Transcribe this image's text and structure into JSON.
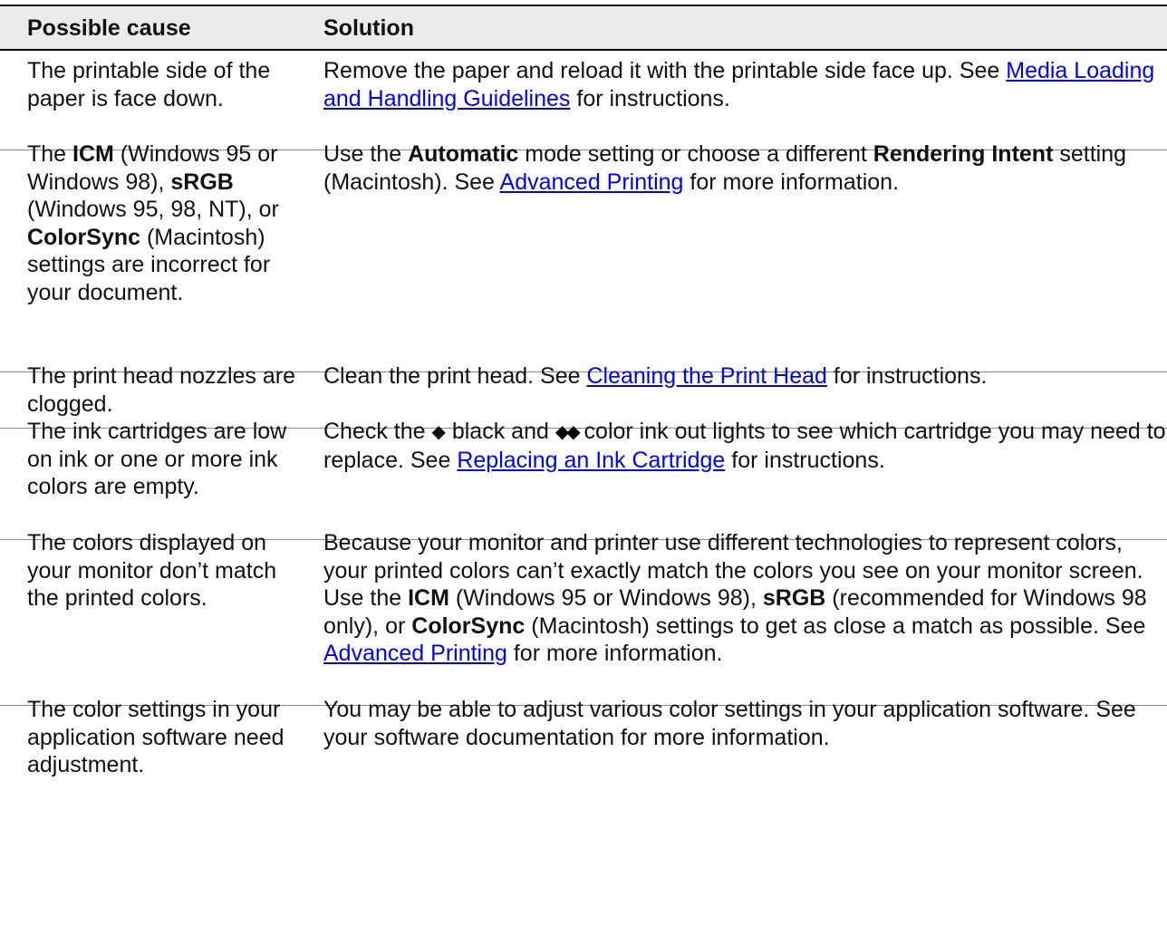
{
  "header": {
    "cause": "Possible cause",
    "solution": "Solution"
  },
  "rows": [
    {
      "cause": [
        [
          "t",
          "The printable side of the paper is face down."
        ]
      ],
      "solution": [
        [
          "t",
          "Remove the paper and reload it with the printable side face up. See "
        ],
        [
          "a",
          "Media Loading and Handling Guidelines"
        ],
        [
          "t",
          " for instructions."
        ]
      ]
    },
    {
      "cause": [
        [
          "t",
          "The "
        ],
        [
          "b",
          "ICM"
        ],
        [
          "t",
          " (Windows 95 or Windows 98), "
        ],
        [
          "b",
          "sRGB"
        ],
        [
          "t",
          " (Windows 95, 98, NT), or "
        ],
        [
          "b",
          "ColorSync"
        ],
        [
          "t",
          " (Macintosh) settings are incorrect for your document."
        ]
      ],
      "solution": [
        [
          "t",
          "Use the "
        ],
        [
          "b",
          "Automatic"
        ],
        [
          "t",
          " mode setting or choose a different "
        ],
        [
          "b",
          "Rendering Intent"
        ],
        [
          "t",
          " setting (Macintosh). See "
        ],
        [
          "a",
          "Advanced Printing"
        ],
        [
          "t",
          " for more information."
        ]
      ]
    },
    {
      "cause": [
        [
          "t",
          "The print head nozzles are clogged."
        ]
      ],
      "solution": [
        [
          "t",
          "Clean the print head. See "
        ],
        [
          "a",
          "Cleaning the Print Head"
        ],
        [
          "t",
          " for instructions."
        ]
      ]
    },
    {
      "cause": [
        [
          "t",
          "The ink cartridges are low on ink or one or more ink colors are empty."
        ]
      ],
      "solution": [
        [
          "t",
          "Check the "
        ],
        [
          "i",
          "black-ink-drop-icon"
        ],
        [
          "t",
          " black and "
        ],
        [
          "i",
          "color-ink-drops-icon"
        ],
        [
          "t",
          " color ink out lights to see which cartridge you may need to replace. See "
        ],
        [
          "a",
          "Replacing an Ink Cartridge"
        ],
        [
          "t",
          " for instructions."
        ]
      ]
    },
    {
      "cause": [
        [
          "t",
          "The colors displayed on your monitor don’t match the printed colors."
        ]
      ],
      "solution": [
        [
          "t",
          "Because your monitor and printer use different technologies to represent colors, your printed colors can’t exactly match the colors you see on your monitor screen. Use the "
        ],
        [
          "b",
          "ICM"
        ],
        [
          "t",
          " (Windows 95 or Windows 98), "
        ],
        [
          "b",
          "sRGB"
        ],
        [
          "t",
          " (recommended for Windows 98 only), or "
        ],
        [
          "b",
          "ColorSync"
        ],
        [
          "t",
          " (Macintosh) settings to get as close a match as possible. See "
        ],
        [
          "a",
          "Advanced Printing"
        ],
        [
          "t",
          " for more information."
        ]
      ]
    },
    {
      "cause": [
        [
          "t",
          "The color settings in your application software need adjustment."
        ]
      ],
      "solution": [
        [
          "t",
          "You may be able to adjust various color settings in your application software. See your software documentation for more information."
        ]
      ]
    }
  ],
  "icons": {
    "black_ink": "◆",
    "color_ink": "◆◆"
  },
  "colors": {
    "link": "#0000ff",
    "header_bg": "#ebebeb",
    "rule": "#000000",
    "separator": "#8c8c8c"
  }
}
